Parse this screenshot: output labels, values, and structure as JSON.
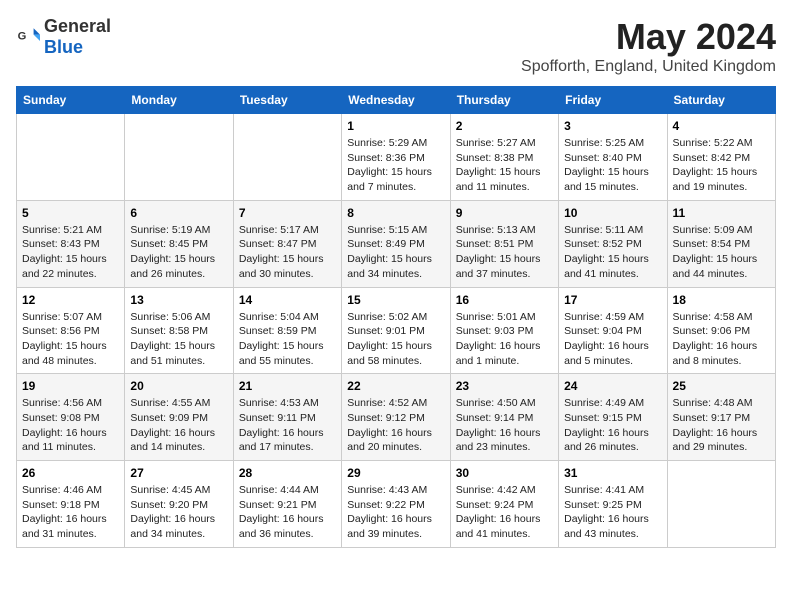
{
  "header": {
    "logo_general": "General",
    "logo_blue": "Blue",
    "title": "May 2024",
    "subtitle": "Spofforth, England, United Kingdom"
  },
  "weekdays": [
    "Sunday",
    "Monday",
    "Tuesday",
    "Wednesday",
    "Thursday",
    "Friday",
    "Saturday"
  ],
  "weeks": [
    [
      {
        "day": "",
        "info": ""
      },
      {
        "day": "",
        "info": ""
      },
      {
        "day": "",
        "info": ""
      },
      {
        "day": "1",
        "info": "Sunrise: 5:29 AM\nSunset: 8:36 PM\nDaylight: 15 hours\nand 7 minutes."
      },
      {
        "day": "2",
        "info": "Sunrise: 5:27 AM\nSunset: 8:38 PM\nDaylight: 15 hours\nand 11 minutes."
      },
      {
        "day": "3",
        "info": "Sunrise: 5:25 AM\nSunset: 8:40 PM\nDaylight: 15 hours\nand 15 minutes."
      },
      {
        "day": "4",
        "info": "Sunrise: 5:22 AM\nSunset: 8:42 PM\nDaylight: 15 hours\nand 19 minutes."
      }
    ],
    [
      {
        "day": "5",
        "info": "Sunrise: 5:21 AM\nSunset: 8:43 PM\nDaylight: 15 hours\nand 22 minutes."
      },
      {
        "day": "6",
        "info": "Sunrise: 5:19 AM\nSunset: 8:45 PM\nDaylight: 15 hours\nand 26 minutes."
      },
      {
        "day": "7",
        "info": "Sunrise: 5:17 AM\nSunset: 8:47 PM\nDaylight: 15 hours\nand 30 minutes."
      },
      {
        "day": "8",
        "info": "Sunrise: 5:15 AM\nSunset: 8:49 PM\nDaylight: 15 hours\nand 34 minutes."
      },
      {
        "day": "9",
        "info": "Sunrise: 5:13 AM\nSunset: 8:51 PM\nDaylight: 15 hours\nand 37 minutes."
      },
      {
        "day": "10",
        "info": "Sunrise: 5:11 AM\nSunset: 8:52 PM\nDaylight: 15 hours\nand 41 minutes."
      },
      {
        "day": "11",
        "info": "Sunrise: 5:09 AM\nSunset: 8:54 PM\nDaylight: 15 hours\nand 44 minutes."
      }
    ],
    [
      {
        "day": "12",
        "info": "Sunrise: 5:07 AM\nSunset: 8:56 PM\nDaylight: 15 hours\nand 48 minutes."
      },
      {
        "day": "13",
        "info": "Sunrise: 5:06 AM\nSunset: 8:58 PM\nDaylight: 15 hours\nand 51 minutes."
      },
      {
        "day": "14",
        "info": "Sunrise: 5:04 AM\nSunset: 8:59 PM\nDaylight: 15 hours\nand 55 minutes."
      },
      {
        "day": "15",
        "info": "Sunrise: 5:02 AM\nSunset: 9:01 PM\nDaylight: 15 hours\nand 58 minutes."
      },
      {
        "day": "16",
        "info": "Sunrise: 5:01 AM\nSunset: 9:03 PM\nDaylight: 16 hours\nand 1 minute."
      },
      {
        "day": "17",
        "info": "Sunrise: 4:59 AM\nSunset: 9:04 PM\nDaylight: 16 hours\nand 5 minutes."
      },
      {
        "day": "18",
        "info": "Sunrise: 4:58 AM\nSunset: 9:06 PM\nDaylight: 16 hours\nand 8 minutes."
      }
    ],
    [
      {
        "day": "19",
        "info": "Sunrise: 4:56 AM\nSunset: 9:08 PM\nDaylight: 16 hours\nand 11 minutes."
      },
      {
        "day": "20",
        "info": "Sunrise: 4:55 AM\nSunset: 9:09 PM\nDaylight: 16 hours\nand 14 minutes."
      },
      {
        "day": "21",
        "info": "Sunrise: 4:53 AM\nSunset: 9:11 PM\nDaylight: 16 hours\nand 17 minutes."
      },
      {
        "day": "22",
        "info": "Sunrise: 4:52 AM\nSunset: 9:12 PM\nDaylight: 16 hours\nand 20 minutes."
      },
      {
        "day": "23",
        "info": "Sunrise: 4:50 AM\nSunset: 9:14 PM\nDaylight: 16 hours\nand 23 minutes."
      },
      {
        "day": "24",
        "info": "Sunrise: 4:49 AM\nSunset: 9:15 PM\nDaylight: 16 hours\nand 26 minutes."
      },
      {
        "day": "25",
        "info": "Sunrise: 4:48 AM\nSunset: 9:17 PM\nDaylight: 16 hours\nand 29 minutes."
      }
    ],
    [
      {
        "day": "26",
        "info": "Sunrise: 4:46 AM\nSunset: 9:18 PM\nDaylight: 16 hours\nand 31 minutes."
      },
      {
        "day": "27",
        "info": "Sunrise: 4:45 AM\nSunset: 9:20 PM\nDaylight: 16 hours\nand 34 minutes."
      },
      {
        "day": "28",
        "info": "Sunrise: 4:44 AM\nSunset: 9:21 PM\nDaylight: 16 hours\nand 36 minutes."
      },
      {
        "day": "29",
        "info": "Sunrise: 4:43 AM\nSunset: 9:22 PM\nDaylight: 16 hours\nand 39 minutes."
      },
      {
        "day": "30",
        "info": "Sunrise: 4:42 AM\nSunset: 9:24 PM\nDaylight: 16 hours\nand 41 minutes."
      },
      {
        "day": "31",
        "info": "Sunrise: 4:41 AM\nSunset: 9:25 PM\nDaylight: 16 hours\nand 43 minutes."
      },
      {
        "day": "",
        "info": ""
      }
    ]
  ]
}
